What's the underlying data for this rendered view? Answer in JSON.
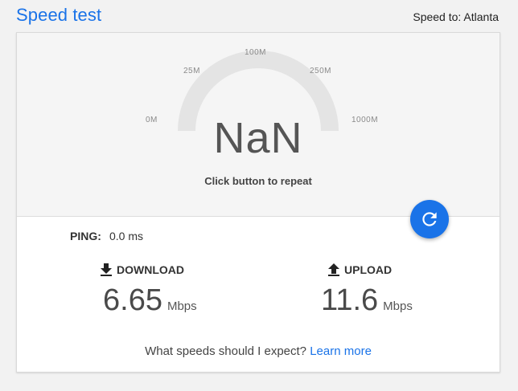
{
  "header": {
    "title": "Speed test",
    "server_label": "Speed to: Atlanta"
  },
  "gauge": {
    "ticks": [
      "0M",
      "25M",
      "100M",
      "250M",
      "1000M"
    ],
    "value": "NaN",
    "caption": "Click button to repeat"
  },
  "ping": {
    "label": "PING:",
    "value": "0.0 ms"
  },
  "download": {
    "label": "DOWNLOAD",
    "value": "6.65",
    "unit": "Mbps"
  },
  "upload": {
    "label": "UPLOAD",
    "value": "11.6",
    "unit": "Mbps"
  },
  "footer": {
    "question": "What speeds should I expect?",
    "link": "Learn more"
  },
  "colors": {
    "accent": "#1a73e8",
    "gauge_track": "#e4e4e4"
  },
  "icons": {
    "repeat": "refresh-icon",
    "download": "download-icon",
    "upload": "upload-icon"
  }
}
